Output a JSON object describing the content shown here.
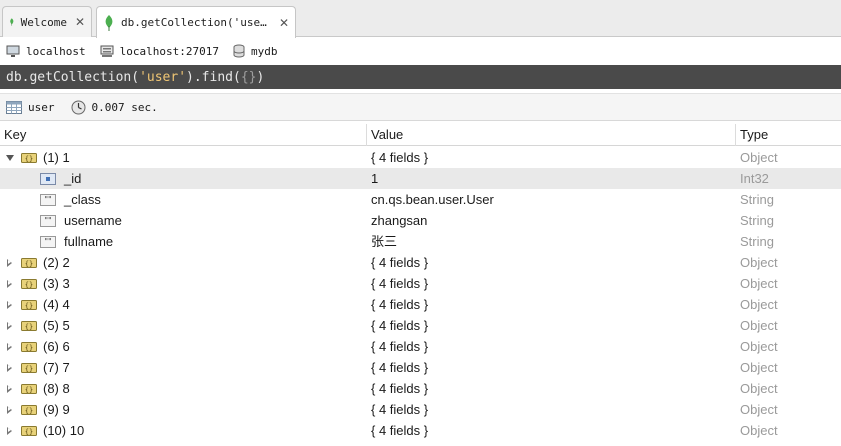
{
  "tabs": [
    {
      "label": "Welcome",
      "close": "✕"
    },
    {
      "label": "db.getCollection('user').…",
      "close": "✕"
    }
  ],
  "connection": {
    "server": "localhost",
    "address": "localhost:27017",
    "database": "mydb"
  },
  "query": {
    "prefix": "db.getCollection(",
    "collection": "'user'",
    "middle": ").find(",
    "arg": "{}",
    "suffix": ")"
  },
  "result": {
    "collection": "user",
    "time": "0.007 sec."
  },
  "columns": {
    "key": "Key",
    "value": "Value",
    "type": "Type"
  },
  "expanded_doc": {
    "key": "(1) 1",
    "value": "{ 4 fields }",
    "type": "Object",
    "fields": [
      {
        "key": "_id",
        "value": "1",
        "type": "Int32",
        "icon": "id-field-icon"
      },
      {
        "key": "_class",
        "value": "cn.qs.bean.user.User",
        "type": "String",
        "icon": "string-field-icon"
      },
      {
        "key": "username",
        "value": "zhangsan",
        "type": "String",
        "icon": "string-field-icon"
      },
      {
        "key": "fullname",
        "value": "张三",
        "type": "String",
        "icon": "string-field-icon"
      }
    ]
  },
  "collapsed_docs": [
    {
      "key": "(2) 2",
      "value": "{ 4 fields }",
      "type": "Object"
    },
    {
      "key": "(3) 3",
      "value": "{ 4 fields }",
      "type": "Object"
    },
    {
      "key": "(4) 4",
      "value": "{ 4 fields }",
      "type": "Object"
    },
    {
      "key": "(5) 5",
      "value": "{ 4 fields }",
      "type": "Object"
    },
    {
      "key": "(6) 6",
      "value": "{ 4 fields }",
      "type": "Object"
    },
    {
      "key": "(7) 7",
      "value": "{ 4 fields }",
      "type": "Object"
    },
    {
      "key": "(8) 8",
      "value": "{ 4 fields }",
      "type": "Object"
    },
    {
      "key": "(9) 9",
      "value": "{ 4 fields }",
      "type": "Object"
    },
    {
      "key": "(10) 10",
      "value": "{ 4 fields }",
      "type": "Object"
    }
  ],
  "colors": {
    "leaf_green": "#4caf50",
    "query_bg": "#4a4a4a",
    "query_string": "#f0c674",
    "type_text": "#9a9a9a",
    "selected_row": "#e9e9e9"
  }
}
